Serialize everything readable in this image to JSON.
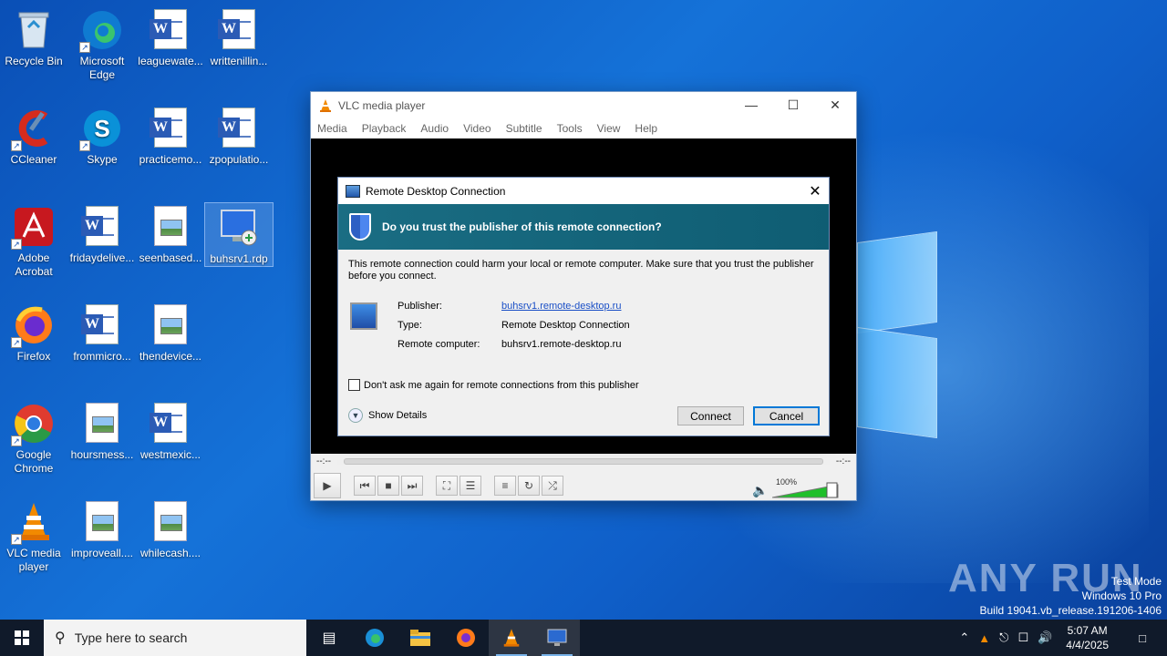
{
  "desktop": {
    "icons": [
      {
        "label": "Recycle Bin",
        "icon": "recycle-bin-icon"
      },
      {
        "label": "Microsoft Edge",
        "icon": "edge-icon"
      },
      {
        "label": "leaguewate...",
        "icon": "word-doc-icon"
      },
      {
        "label": "writtenillin...",
        "icon": "word-doc-icon"
      },
      {
        "label": "CCleaner",
        "icon": "ccleaner-icon"
      },
      {
        "label": "Skype",
        "icon": "skype-icon"
      },
      {
        "label": "practicemo...",
        "icon": "word-doc-icon"
      },
      {
        "label": "zpopulatio...",
        "icon": "word-doc-icon"
      },
      {
        "label": "Adobe Acrobat",
        "icon": "acrobat-icon"
      },
      {
        "label": "fridaydelive...",
        "icon": "word-doc-icon"
      },
      {
        "label": "seenbased...",
        "icon": "image-file-icon"
      },
      {
        "label": "buhsrv1.rdp",
        "icon": "rdp-file-icon"
      },
      {
        "label": "Firefox",
        "icon": "firefox-icon"
      },
      {
        "label": "frommicro...",
        "icon": "word-doc-icon"
      },
      {
        "label": "thendevice...",
        "icon": "image-file-icon"
      },
      {
        "label": "Google Chrome",
        "icon": "chrome-icon"
      },
      {
        "label": "hoursmess...",
        "icon": "image-file-icon"
      },
      {
        "label": "westmexic...",
        "icon": "word-doc-icon"
      },
      {
        "label": "VLC media player",
        "icon": "vlc-icon"
      },
      {
        "label": "improveall....",
        "icon": "image-file-icon"
      },
      {
        "label": "whilecash....",
        "icon": "image-file-icon"
      }
    ]
  },
  "vlc": {
    "title": "VLC media player",
    "menu": [
      "Media",
      "Playback",
      "Audio",
      "Video",
      "Subtitle",
      "Tools",
      "View",
      "Help"
    ],
    "time_left": "--:--",
    "time_right": "--:--",
    "volume": "100%"
  },
  "rdp": {
    "title": "Remote Desktop Connection",
    "banner": "Do you trust the publisher of this remote connection?",
    "message": "This remote connection could harm your local or remote computer. Make sure that you trust the publisher before you connect.",
    "publisher_label": "Publisher:",
    "publisher_value": "buhsrv1.remote-desktop.ru",
    "type_label": "Type:",
    "type_value": "Remote Desktop Connection",
    "remote_label": "Remote computer:",
    "remote_value": "buhsrv1.remote-desktop.ru",
    "checkbox_label": "Don't ask me again for remote connections from this publisher",
    "details_label": "Show Details",
    "connect_label": "Connect",
    "cancel_label": "Cancel"
  },
  "taskbar": {
    "search_placeholder": "Type here to search",
    "time": "5:07 AM",
    "date": "4/4/2025"
  },
  "watermark": {
    "line1": "Test Mode",
    "line2": "Windows 10 Pro",
    "line3": "Build 19041.vb_release.191206-1406",
    "logo": "ANY RUN"
  },
  "colors": {
    "banner": "#1a6d83",
    "desktop": "#1572d8",
    "taskbar": "#101a2a",
    "primary_button_border": "#0078d7"
  }
}
